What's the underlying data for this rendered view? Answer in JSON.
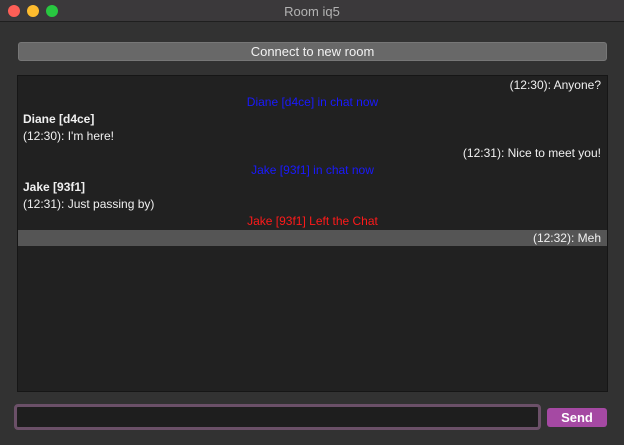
{
  "window": {
    "title": "Room iq5"
  },
  "toolbar": {
    "connect_label": "Connect to new room"
  },
  "chat": {
    "messages": [
      {
        "kind": "own",
        "text": "(12:30): Anyone?"
      },
      {
        "kind": "system-join",
        "text": "Diane [d4ce] in chat now",
        "color": "#1a1aff"
      },
      {
        "kind": "sender",
        "text": "Diane [d4ce]"
      },
      {
        "kind": "body",
        "text": " (12:30): I'm here!"
      },
      {
        "kind": "own",
        "text": "(12:31): Nice to meet you!"
      },
      {
        "kind": "system-join",
        "text": "Jake [93f1] in chat now",
        "color": "#1a1aff"
      },
      {
        "kind": "sender",
        "text": "Jake [93f1]"
      },
      {
        "kind": "body",
        "text": " (12:31): Just passing by)"
      },
      {
        "kind": "system-leave",
        "text": "Jake [93f1] Left the Chat",
        "color": "#ff1a1a"
      },
      {
        "kind": "own-selected",
        "text": "(12:32): Meh"
      }
    ]
  },
  "composer": {
    "input_value": "",
    "send_label": "Send"
  },
  "colors": {
    "accent": "#a549a3",
    "join": "#1a1aff",
    "leave": "#ff1a1a"
  }
}
